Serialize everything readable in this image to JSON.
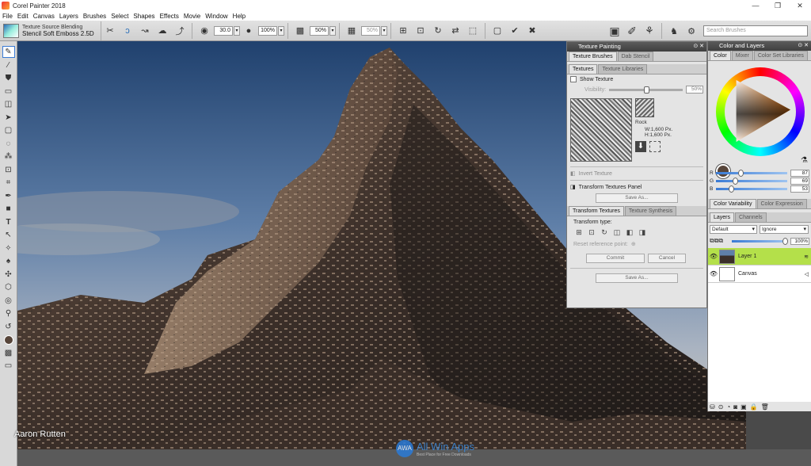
{
  "window": {
    "title": "Corel Painter 2018",
    "controls": [
      "—",
      "❐",
      "✕"
    ]
  },
  "menu": [
    "File",
    "Edit",
    "Canvas",
    "Layers",
    "Brushes",
    "Select",
    "Shapes",
    "Effects",
    "Movie",
    "Window",
    "Help"
  ],
  "propbar": {
    "brush_category": "Texture Source Blending",
    "brush_variant": "Stencil Soft Emboss 2.5D",
    "size_value": "30.0",
    "opacity_value": "100%",
    "grain_value": "50%",
    "blend_value": "50%",
    "search_placeholder": "Search Brushes"
  },
  "canvas": {
    "artist_credit": "Aaron Rutten"
  },
  "watermark": {
    "name": "All Win Apps",
    "tagline": "Best Place for Free Downloads"
  },
  "texture_painting": {
    "title": "Texture Painting",
    "tabs": [
      "Texture Brushes",
      "Dab Stencil"
    ],
    "textures_tabs": [
      "Textures",
      "Texture Libraries"
    ],
    "show_texture": "Show Texture",
    "visibility_label": "Visibility:",
    "visibility_value": "50%",
    "visibility_fraction": 0.5,
    "texture_name": "Rock",
    "texture_w": "W:1,600 Px.",
    "texture_h": "H:1,600 Px.",
    "invert_texture": "Invert Texture",
    "transform_panel": "Transform Textures Panel",
    "save_as": "Save As...",
    "transform_tabs": [
      "Transform Textures",
      "Texture Synthesis"
    ],
    "transform_type": "Transform type:",
    "reset_ref": "Reset reference point:",
    "commit": "Commit",
    "cancel": "Cancel",
    "save_as_2": "Save As..."
  },
  "color_panel": {
    "title": "Color and Layers",
    "tabs": [
      "Color",
      "Mixer",
      "Color Set Libraries"
    ],
    "rgb": [
      {
        "label": "R",
        "value": "87",
        "fraction": 0.34
      },
      {
        "label": "G",
        "value": "69",
        "fraction": 0.27
      },
      {
        "label": "B",
        "value": "53",
        "fraction": 0.21
      }
    ],
    "main_color": "#57453a",
    "variability_tabs": [
      "Color Variability",
      "Color Expression"
    ]
  },
  "layers_panel": {
    "tabs": [
      "Layers",
      "Channels"
    ],
    "composite_method": "Default",
    "depth": "Ignore",
    "opacity": "100%",
    "opacity_fraction": 1.0,
    "items": [
      {
        "name": "Layer 1",
        "selected": true
      },
      {
        "name": "Canvas",
        "selected": false
      }
    ]
  },
  "colors": {
    "accent": "#3a7bd5",
    "layer_selected": "#b4e04a",
    "panel_header": "#4a4a4a"
  }
}
